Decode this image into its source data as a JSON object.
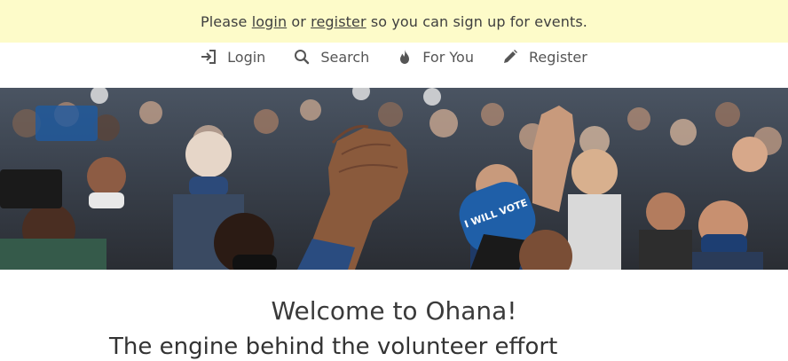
{
  "notice": {
    "prefix": "Please ",
    "login_link": "login",
    "middle": " or ",
    "register_link": "register",
    "suffix": " so you can sign up for events."
  },
  "nav": {
    "items": [
      {
        "label": "Login",
        "icon": "login-icon"
      },
      {
        "label": "Search",
        "icon": "search-icon"
      },
      {
        "label": "For You",
        "icon": "flame-icon"
      },
      {
        "label": "Register",
        "icon": "pencil-icon"
      }
    ]
  },
  "hero": {
    "sign_text": "I WILL VOTE"
  },
  "main": {
    "title": "Welcome to Ohana!",
    "subtitle": "The engine behind the volunteer effort"
  },
  "colors": {
    "notice_bg": "#fdfbc9",
    "text": "#3a3a3a",
    "sign_blue": "#1f5fa8"
  }
}
